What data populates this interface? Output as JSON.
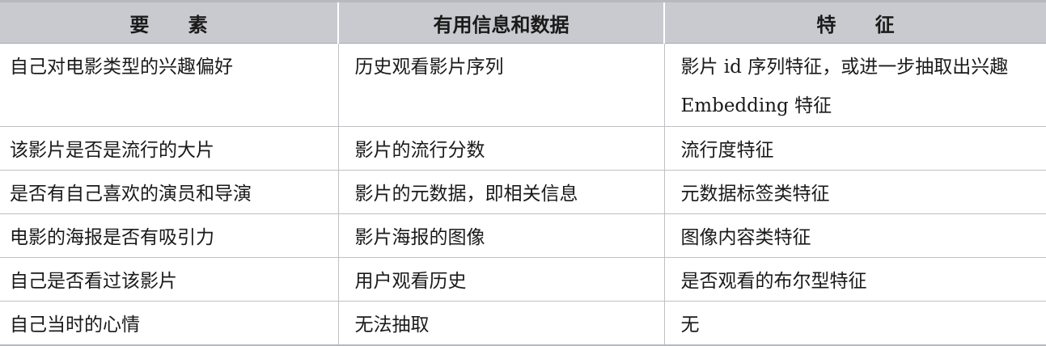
{
  "table": {
    "headers": [
      "要 素",
      "有用信息和数据",
      "特 征"
    ],
    "rows": [
      [
        "自己对电影类型的兴趣偏好",
        "历史观看影片序列",
        "影片 id 序列特征，或进一步抽取出兴趣 Embedding 特征"
      ],
      [
        "该影片是否是流行的大片",
        "影片的流行分数",
        "流行度特征"
      ],
      [
        "是否有自己喜欢的演员和导演",
        "影片的元数据，即相关信息",
        "元数据标签类特征"
      ],
      [
        "电影的海报是否有吸引力",
        "影片海报的图像",
        "图像内容类特征"
      ],
      [
        "自己是否看过该影片",
        "用户观看历史",
        "是否观看的布尔型特征"
      ],
      [
        "自己当时的心情",
        "无法抽取",
        "无"
      ]
    ]
  }
}
